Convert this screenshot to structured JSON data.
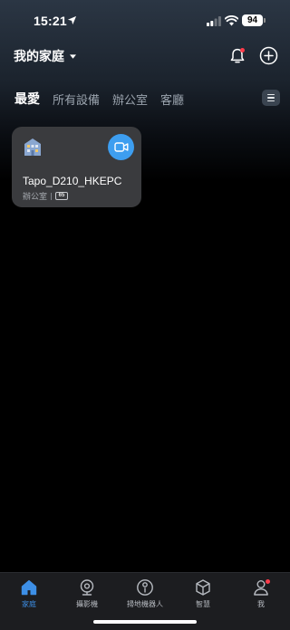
{
  "status_bar": {
    "time": "15:21",
    "battery": "94",
    "icons": [
      "location-arrow-icon",
      "signal-icon",
      "wifi-icon",
      "battery-icon"
    ]
  },
  "header": {
    "home_name": "我的家庭",
    "icons": [
      "caret-down-icon",
      "bell-icon",
      "add-icon"
    ]
  },
  "tabs": [
    {
      "label": "最愛",
      "active": true
    },
    {
      "label": "所有設備",
      "active": false
    },
    {
      "label": "辦公室",
      "active": false
    },
    {
      "label": "客廳",
      "active": false
    }
  ],
  "device": {
    "name": "Tapo_D210_HKEPC",
    "room": "辦公室",
    "signal": "65",
    "icons": [
      "building-icon",
      "camera-icon"
    ]
  },
  "bottom_nav": [
    {
      "label": "家庭",
      "icon": "home-icon",
      "active": true
    },
    {
      "label": "攝影機",
      "icon": "webcam-icon",
      "active": false
    },
    {
      "label": "掃地機器人",
      "icon": "robot-vacuum-icon",
      "active": false
    },
    {
      "label": "智慧",
      "icon": "cube-icon",
      "active": false
    },
    {
      "label": "我",
      "icon": "user-icon",
      "active": false
    }
  ],
  "colors": {
    "accent": "#3d8fe6",
    "camera_button": "#3d9ef0",
    "notification_dot": "#ff3b4a",
    "card": "#3a3b3e"
  }
}
